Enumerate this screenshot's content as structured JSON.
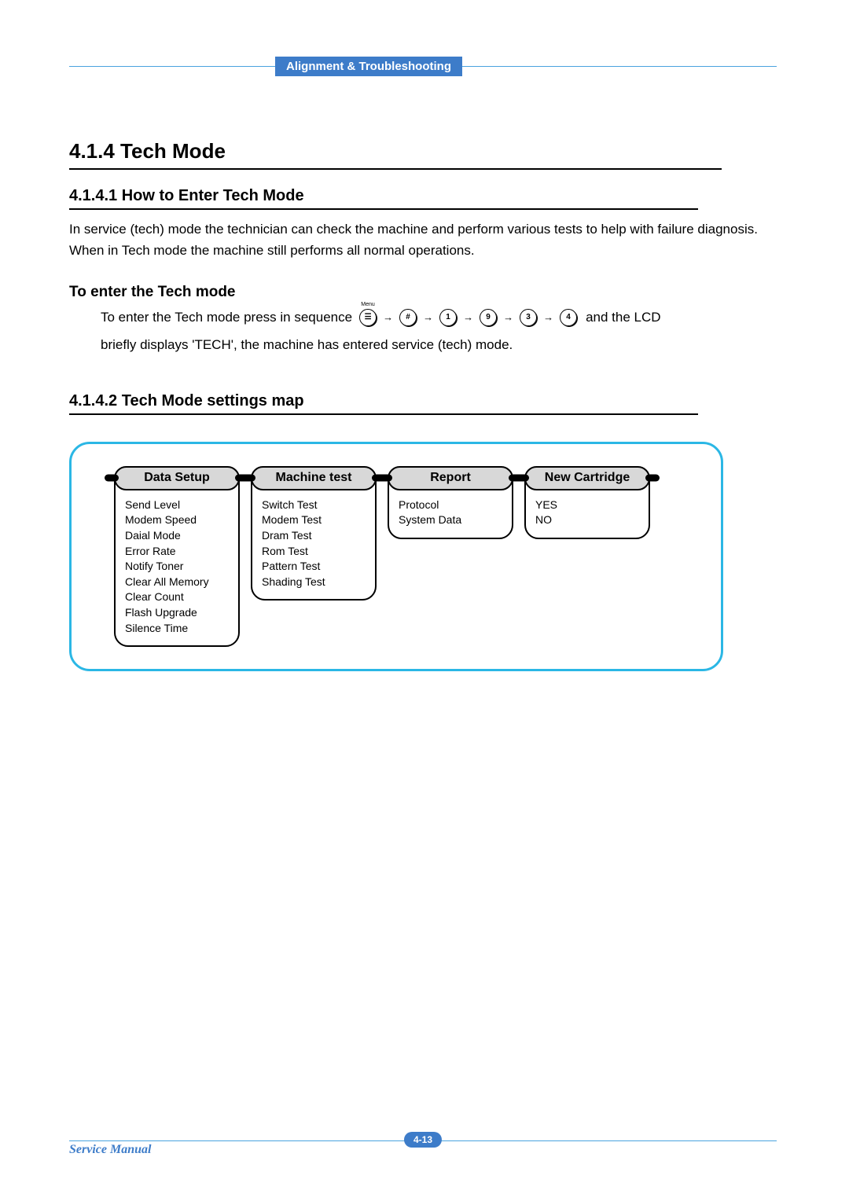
{
  "header": {
    "section_label": "Alignment & Troubleshooting"
  },
  "h2": "4.1.4 Tech Mode",
  "sec1": {
    "title": "4.1.4.1 How to Enter Tech Mode",
    "p1": "In service (tech) mode the technician can check the machine and perform various tests to help with failure diagnosis.",
    "p2": "When in Tech mode the machine still performs all normal operations.",
    "subhead": "To enter the Tech mode",
    "seq_lead": "To enter the Tech mode press in sequence",
    "seq_tail": "and the LCD",
    "seq_line2": "briefly displays 'TECH', the machine has entered service (tech) mode.",
    "keys": {
      "menu_label": "Menu",
      "menu_glyph": "☰",
      "hash": "#",
      "k1": "1",
      "k9": "9",
      "k3": "3",
      "k4": "4"
    }
  },
  "sec2": {
    "title": "4.1.4.2 Tech Mode settings map",
    "menus": [
      {
        "title": "Data Setup",
        "items": [
          "Send Level",
          "Modem Speed",
          "Daial Mode",
          "Error Rate",
          "Notify Toner",
          "Clear All Memory",
          "Clear Count",
          "Flash Upgrade",
          "Silence Time"
        ]
      },
      {
        "title": "Machine test",
        "items": [
          "Switch Test",
          "Modem Test",
          "Dram Test",
          "Rom Test",
          "Pattern Test",
          "Shading Test"
        ]
      },
      {
        "title": "Report",
        "items": [
          "Protocol",
          "System Data"
        ]
      },
      {
        "title": "New Cartridge",
        "items": [
          "YES",
          "NO"
        ]
      }
    ]
  },
  "footer": {
    "doc_title": "Service Manual",
    "page_num": "4-13"
  }
}
